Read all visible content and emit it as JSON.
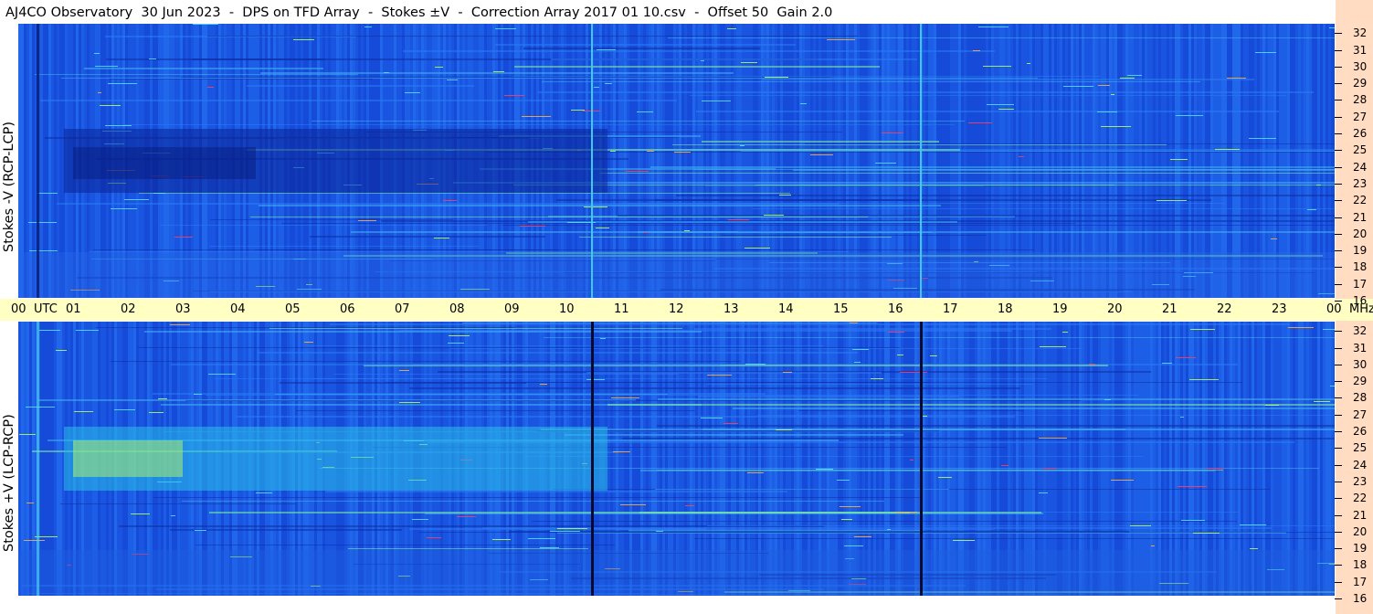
{
  "title": "AJ4CO Observatory  30 Jun 2023  -  DPS on TFD Array  -  Stokes ±V  -  Correction Array 2017 01 10.csv  -  Offset 50  Gain 2.0",
  "panels": {
    "top_label": "Stokes -V (RCP-LCP)",
    "bottom_label": "Stokes +V (LCP-RCP)"
  },
  "time_axis": {
    "labels": [
      "00",
      "UTC",
      "01",
      "02",
      "03",
      "04",
      "05",
      "06",
      "07",
      "08",
      "09",
      "10",
      "11",
      "12",
      "13",
      "14",
      "15",
      "16",
      "17",
      "18",
      "19",
      "20",
      "21",
      "22",
      "23",
      "00",
      "MHz"
    ]
  },
  "freq_axis": {
    "labels": [
      "32",
      "31",
      "30",
      "29",
      "28",
      "27",
      "26",
      "25",
      "24",
      "23",
      "22",
      "21",
      "20",
      "19",
      "18",
      "17",
      "16"
    ]
  },
  "colors": {
    "background_blue": "#1a55e0",
    "time_bar": "#ffffc4",
    "side_strip": "#ffdcc2"
  },
  "chart_data": {
    "type": "heatmap",
    "title": "AJ4CO Observatory  30 Jun 2023  -  DPS on TFD Array  -  Stokes ±V  -  Correction Array 2017 01 10.csv  -  Offset 50  Gain 2.0",
    "x": [
      "00",
      "01",
      "02",
      "03",
      "04",
      "05",
      "06",
      "07",
      "08",
      "09",
      "10",
      "11",
      "12",
      "13",
      "14",
      "15",
      "16",
      "17",
      "18",
      "19",
      "20",
      "21",
      "22",
      "23",
      "00"
    ],
    "xlabel": "UTC",
    "xlim": [
      0,
      24
    ],
    "ylabel": "MHz",
    "ylim": [
      16,
      32
    ],
    "panels": [
      "Stokes -V (RCP-LCP)",
      "Stokes +V (LCP-RCP)"
    ]
  }
}
